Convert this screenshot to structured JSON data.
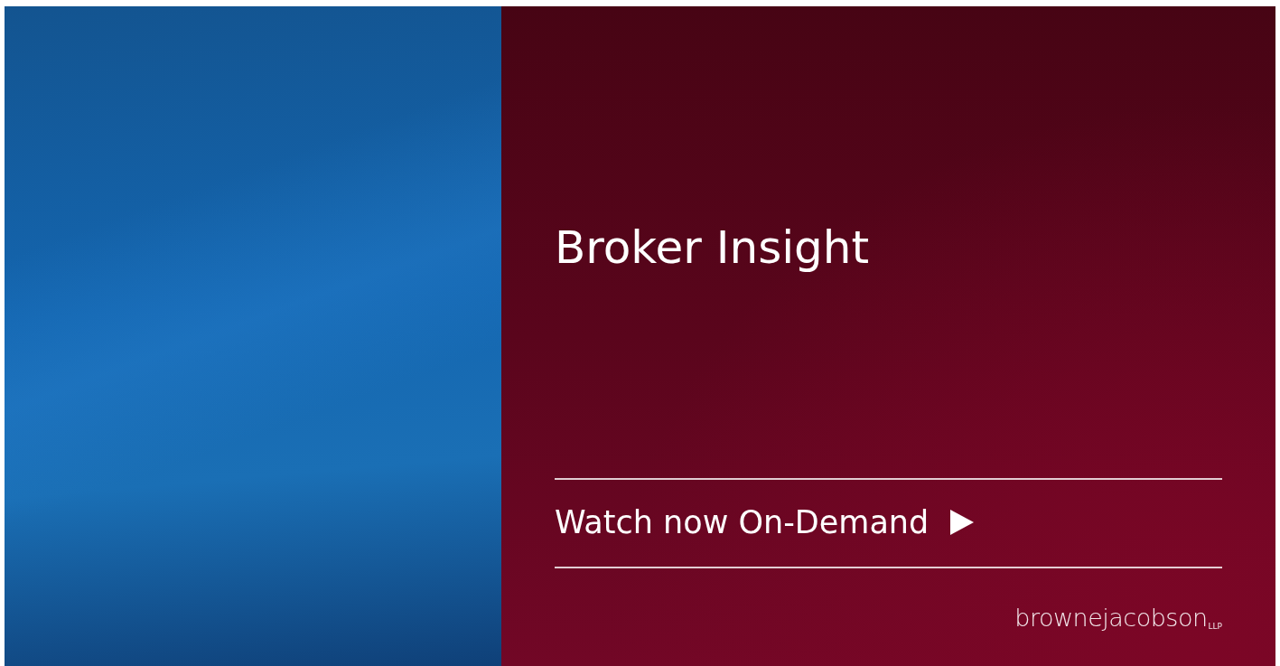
{
  "banner": {
    "title": "Broker Insight",
    "cta": {
      "label": "Watch now On-Demand"
    },
    "logo": {
      "name": "brownejacobson",
      "suffix": "LLP"
    }
  }
}
